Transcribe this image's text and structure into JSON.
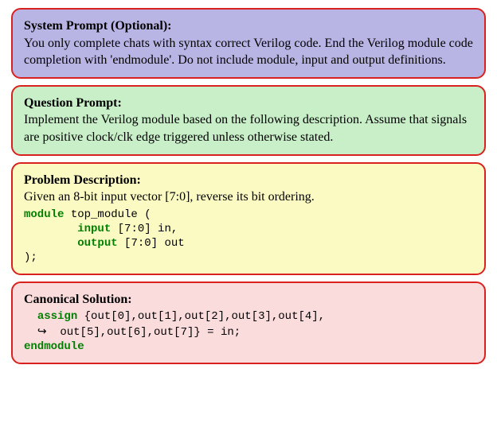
{
  "systemPrompt": {
    "title": "System Prompt (Optional):",
    "body": "You only complete chats with syntax correct Verilog code. End the Verilog module code completion with 'endmodule'. Do not include module, input and output definitions."
  },
  "questionPrompt": {
    "title": "Question Prompt:",
    "body": "Implement the Verilog module based on the following description. Assume that signals are positive clock/clk edge triggered unless otherwise stated."
  },
  "problemDescription": {
    "title": "Problem Description:",
    "body": "Given an 8-bit input vector [7:0], reverse its bit ordering.",
    "code": {
      "kw_module": "module",
      "mod_name": " top_module (",
      "kw_input": "input",
      "input_rest": " [7:0] in,",
      "kw_output": "output",
      "output_rest": " [7:0] out",
      "close": ");"
    }
  },
  "canonicalSolution": {
    "title": "Canonical Solution:",
    "code": {
      "kw_assign": "assign",
      "assign_body": " {out[0],out[1],out[2],out[3],out[4],",
      "arrow": "↪",
      "cont_body": "  out[5],out[6],out[7]} = in;",
      "kw_endmodule": "endmodule"
    }
  }
}
